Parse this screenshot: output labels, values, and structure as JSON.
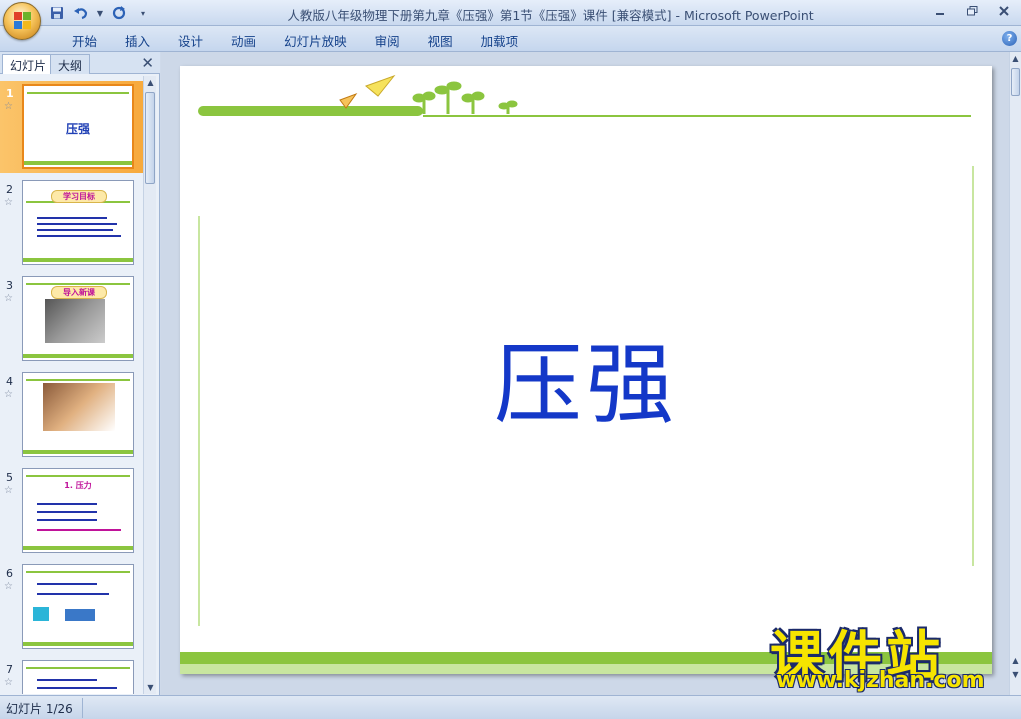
{
  "window": {
    "title": "人教版八年级物理下册第九章《压强》第1节《压强》课件 [兼容模式] - Microsoft PowerPoint"
  },
  "quick_access": {
    "save_icon": "save-icon",
    "undo_icon": "undo-icon",
    "redo_icon": "redo-icon",
    "customize_icon": "dropdown-icon"
  },
  "ribbon": {
    "tabs": [
      "开始",
      "插入",
      "设计",
      "动画",
      "幻灯片放映",
      "审阅",
      "视图",
      "加载项"
    ],
    "help": "?"
  },
  "left_pane": {
    "tab_slides": "幻灯片",
    "tab_outline": "大纲",
    "close": "✕",
    "thumbnails": [
      {
        "num": "1",
        "star": "☆",
        "title": "压强"
      },
      {
        "num": "2",
        "star": "☆",
        "badge": "学习目标"
      },
      {
        "num": "3",
        "star": "☆",
        "badge": "导入新课"
      },
      {
        "num": "4",
        "star": "☆"
      },
      {
        "num": "5",
        "star": "☆",
        "title": "1. 压力"
      },
      {
        "num": "6",
        "star": "☆"
      },
      {
        "num": "7",
        "star": "☆"
      }
    ]
  },
  "slide": {
    "title": "压强"
  },
  "watermark": {
    "main": "课件站",
    "url": "www.kjzhan.com"
  },
  "status": {
    "slide_indicator": "幻灯片 1/26"
  },
  "colors": {
    "accent_green": "#8bc53f",
    "title_blue": "#1438c8",
    "selection_orange": "#f7a93c"
  }
}
